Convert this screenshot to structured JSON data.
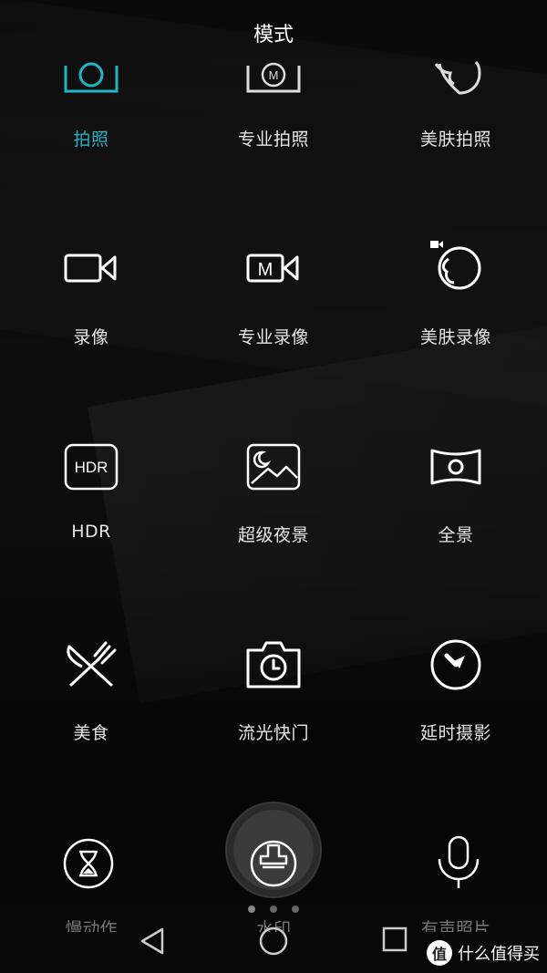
{
  "header": {
    "title": "模式"
  },
  "modes": [
    {
      "label": "拍照",
      "icon": "camera-icon",
      "active": true
    },
    {
      "label": "专业拍照",
      "icon": "pro-camera-icon",
      "active": false
    },
    {
      "label": "美肤拍照",
      "icon": "beauty-face-icon",
      "active": false
    },
    {
      "label": "录像",
      "icon": "video-icon",
      "active": false
    },
    {
      "label": "专业录像",
      "icon": "pro-video-icon",
      "active": false
    },
    {
      "label": "美肤录像",
      "icon": "beauty-video-icon",
      "active": false
    },
    {
      "label": "HDR",
      "icon": "hdr-icon",
      "active": false
    },
    {
      "label": "超级夜景",
      "icon": "night-scene-icon",
      "active": false
    },
    {
      "label": "全景",
      "icon": "panorama-icon",
      "active": false
    },
    {
      "label": "美食",
      "icon": "food-icon",
      "active": false
    },
    {
      "label": "流光快门",
      "icon": "light-painting-icon",
      "active": false
    },
    {
      "label": "延时摄影",
      "icon": "time-lapse-icon",
      "active": false
    }
  ],
  "hdr_icon_text": "HDR",
  "pro_icon_text": "M",
  "bottom": {
    "left_label": "慢动作",
    "center_label": "水印",
    "right_label": "有声照片"
  },
  "watermark": {
    "logo": "值",
    "text": "什么值得买"
  },
  "colors": {
    "accent": "#23b4c4",
    "background": "#141414"
  }
}
